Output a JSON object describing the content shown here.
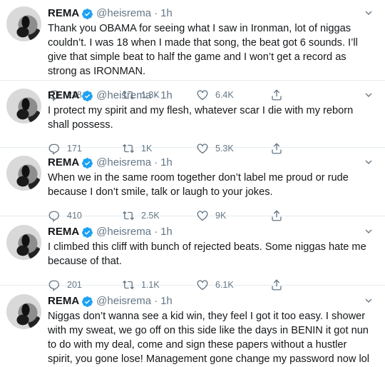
{
  "tweets": [
    {
      "name": "REMA",
      "handle": "@heisrema",
      "dot": "·",
      "time": "1h",
      "text": "Thank you OBAMA for seeing what I saw in Ironman, lot of niggas couldn’t. I was 18 when I made that song, the beat got 6 sounds. I’ll give that simple beat to half the game and I won’t get a record as strong as IRONMAN.",
      "replies": "228",
      "retweets": "1.3K",
      "likes": "6.4K"
    },
    {
      "name": "REMA",
      "handle": "@heisrema",
      "dot": "·",
      "time": "1h",
      "text": "I protect my spirit and my flesh, whatever scar I die with my reborn shall possess.",
      "replies": "171",
      "retweets": "1K",
      "likes": "5.3K"
    },
    {
      "name": "REMA",
      "handle": "@heisrema",
      "dot": "·",
      "time": "1h",
      "text": "When we in the same room together don’t label me proud or rude because I don’t smile, talk or laugh to your jokes.",
      "replies": "410",
      "retweets": "2.5K",
      "likes": "9K"
    },
    {
      "name": "REMA",
      "handle": "@heisrema",
      "dot": "·",
      "time": "1h",
      "text": "I climbed this cliff with bunch of rejected beats. Some niggas hate me because of that.",
      "replies": "201",
      "retweets": "1.1K",
      "likes": "6.1K"
    },
    {
      "name": "REMA",
      "handle": "@heisrema",
      "dot": "·",
      "time": "1h",
      "text": "Niggas don’t wanna see a kid win, they feel I got it too easy. I shower with my sweat, we go off on this side like the days in BENIN it got nun to do with my deal, come and sign these papers without a hustler spirit, you gone lose! Management gone change my password now lol 💀",
      "replies": "",
      "retweets": "",
      "likes": ""
    }
  ],
  "icons": {
    "verified": "verified-badge-icon",
    "caret": "chevron-down-icon",
    "reply": "reply-icon",
    "retweet": "retweet-icon",
    "like": "heart-icon",
    "share": "share-icon"
  },
  "colors": {
    "verified": "#1da1f2",
    "text": "#14171a",
    "secondary": "#657786",
    "divider": "#e6ecf0"
  }
}
